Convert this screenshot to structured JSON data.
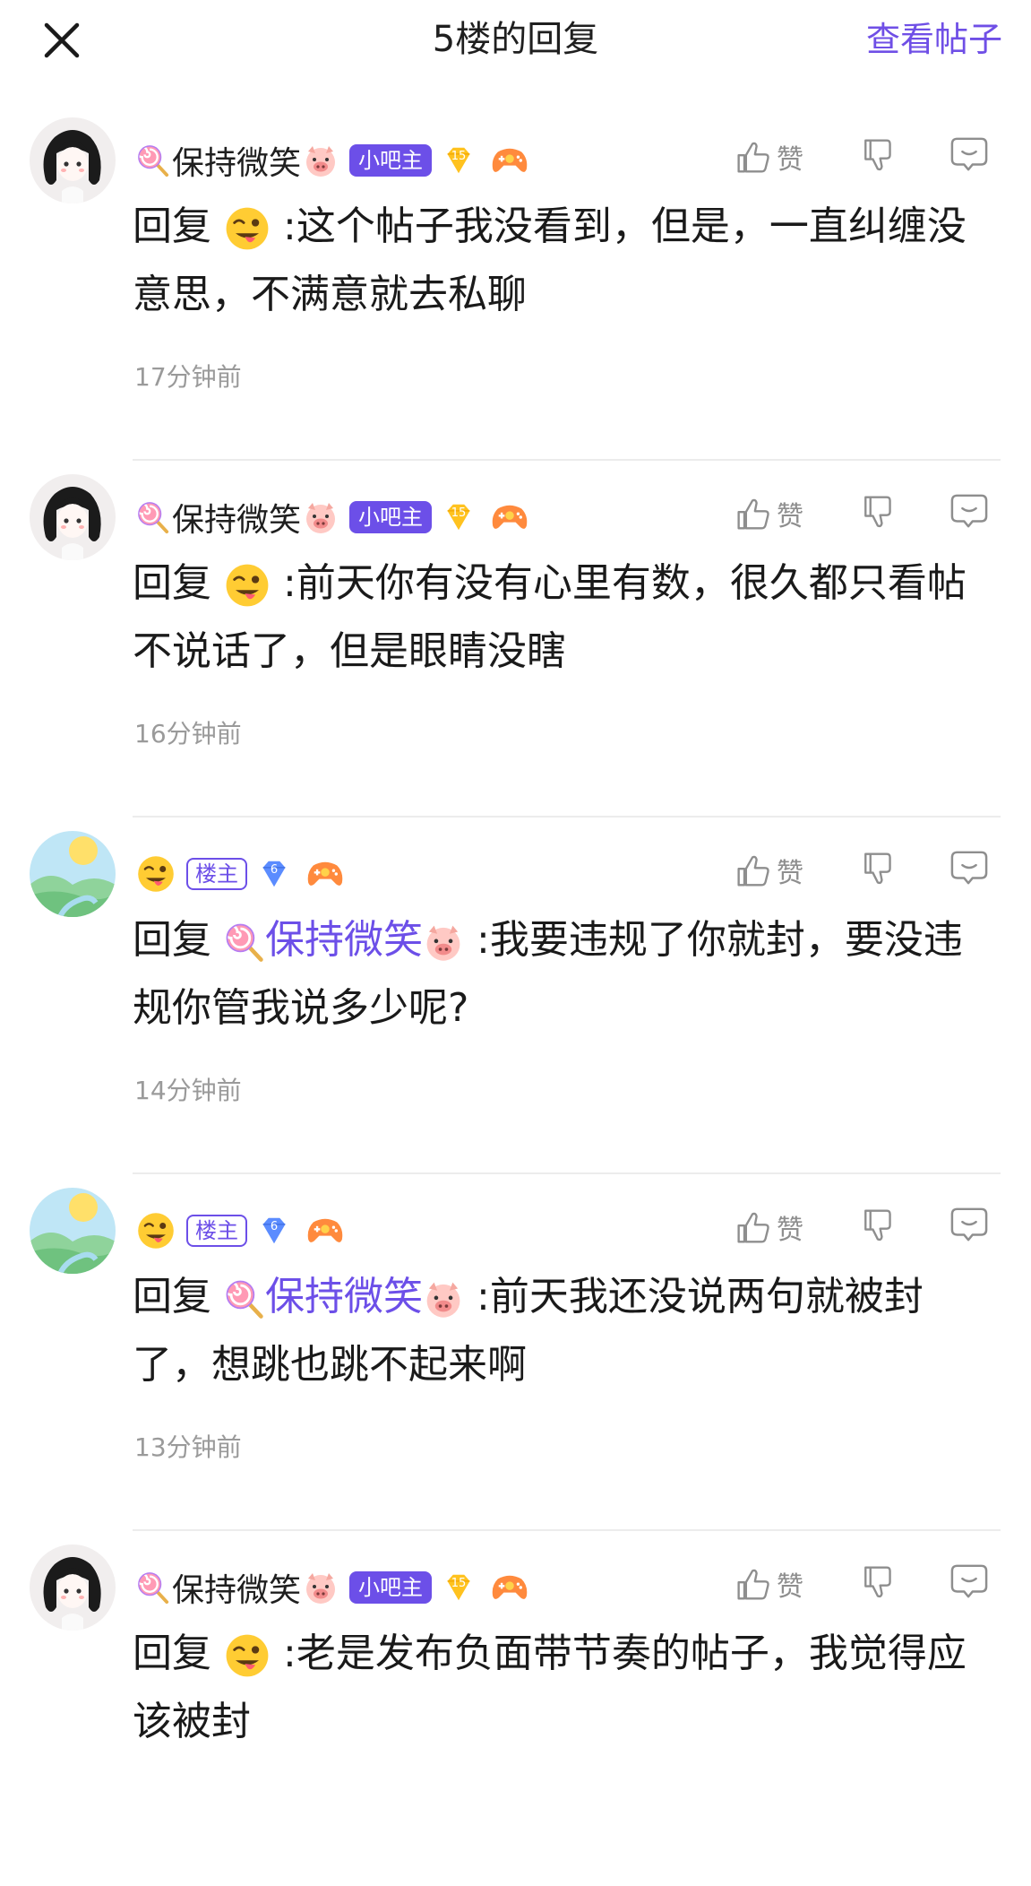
{
  "header": {
    "title": "5楼的回复",
    "view_post": "查看帖子"
  },
  "colors": {
    "accent": "#6c4fe8",
    "time": "#9a9a9a"
  },
  "actions": {
    "like": "赞"
  },
  "users": {
    "moderator": {
      "name": "保持微笑",
      "badge": "小吧主",
      "level": "15"
    },
    "op": {
      "badge": "楼主",
      "level": "6"
    }
  },
  "comments": [
    {
      "reply_prefix": "回复",
      "text": ":这个帖子我没看到，但是，一直纠缠没意思，不满意就去私聊",
      "time": "17分钟前"
    },
    {
      "reply_prefix": "回复",
      "text": ":前天你有没有心里有数，很久都只看帖不说话了，但是眼睛没瞎",
      "time": "16分钟前"
    },
    {
      "reply_prefix": "回复",
      "mention": "保持微笑",
      "text": ":我要违规了你就封，要没违规你管我说多少呢?",
      "time": "14分钟前"
    },
    {
      "reply_prefix": "回复",
      "mention": "保持微笑",
      "text": ":前天我还没说两句就被封了，想跳也跳不起来啊",
      "time": "13分钟前"
    },
    {
      "reply_prefix": "回复",
      "text": ":老是发布负面带节奏的帖子，我觉得应该被封",
      "time": ""
    }
  ]
}
